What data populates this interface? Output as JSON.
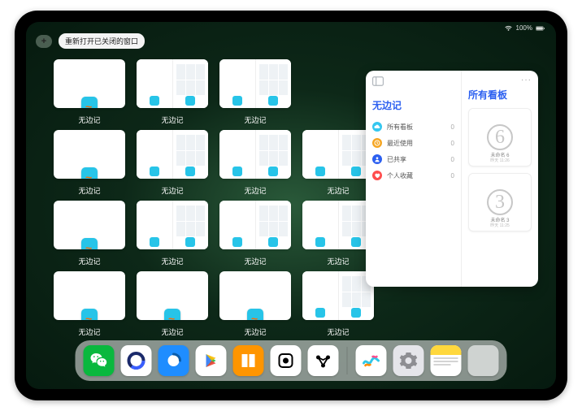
{
  "status": {
    "battery": "100%"
  },
  "topbar": {
    "plus": "+",
    "tip": "重新打开已关闭的窗口"
  },
  "windows": {
    "rows": 4,
    "cols": 4,
    "label": "无边记"
  },
  "preview": {
    "title": "无边记",
    "right_title": "所有看板",
    "items": [
      {
        "icon": "cloud",
        "color": "#34c7f0",
        "label": "所有看板",
        "count": "0"
      },
      {
        "icon": "clock",
        "color": "#f5a623",
        "label": "最近使用",
        "count": "0"
      },
      {
        "icon": "person",
        "color": "#2b5ff0",
        "label": "已共享",
        "count": "0"
      },
      {
        "icon": "heart",
        "color": "#ff4d4d",
        "label": "个人收藏",
        "count": "0"
      }
    ],
    "boards": [
      {
        "digit": "6",
        "title": "未命名 6",
        "sub": "昨天 11:26"
      },
      {
        "digit": "3",
        "title": "未命名 3",
        "sub": "昨天 11:25"
      }
    ]
  },
  "dock": {
    "apps": [
      {
        "name": "wechat",
        "bg": "#09b83e"
      },
      {
        "name": "quark",
        "bg": "#ffffff"
      },
      {
        "name": "qqbrowser",
        "bg": "#1f8dff"
      },
      {
        "name": "play",
        "bg": "#ffffff"
      },
      {
        "name": "books",
        "bg": "#ff9500"
      },
      {
        "name": "dice",
        "bg": "#ffffff"
      },
      {
        "name": "mesh",
        "bg": "#ffffff"
      },
      {
        "name": "freeform",
        "bg": "#ffffff"
      },
      {
        "name": "settings",
        "bg": "#e5e5ea"
      },
      {
        "name": "notes",
        "bg": "#fff7d1"
      }
    ]
  }
}
